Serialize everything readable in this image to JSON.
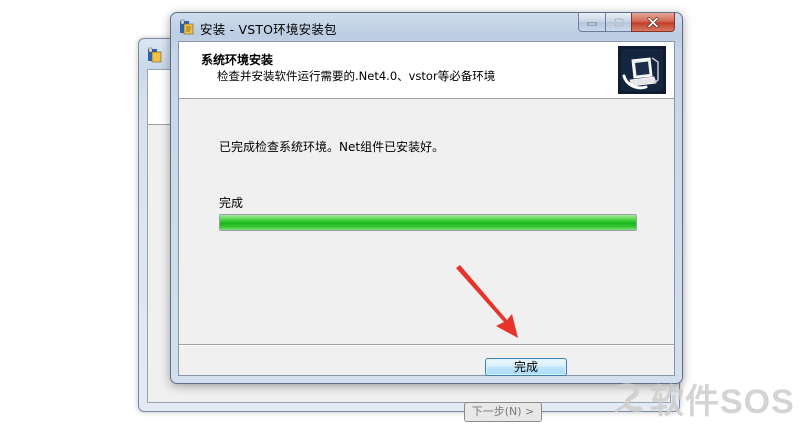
{
  "window": {
    "title": "安装 - VSTO环境安装包"
  },
  "header": {
    "title": "系统环境安装",
    "subtitle": "检查并安装软件运行需要的.Net4.0、vstor等必备环境"
  },
  "main": {
    "status_message": "已完成检查系统环境。Net组件已安装好。",
    "progress_label": "完成",
    "progress_percent": 100
  },
  "footer": {
    "finish_label": "完成"
  },
  "background_window": {
    "next_label": "下一步(N) >"
  },
  "watermark": {
    "text": "软件SOS"
  },
  "colors": {
    "progress_green": "#1bb41c",
    "annotation_arrow": "#e8332b",
    "close_button": "#c0402a"
  }
}
